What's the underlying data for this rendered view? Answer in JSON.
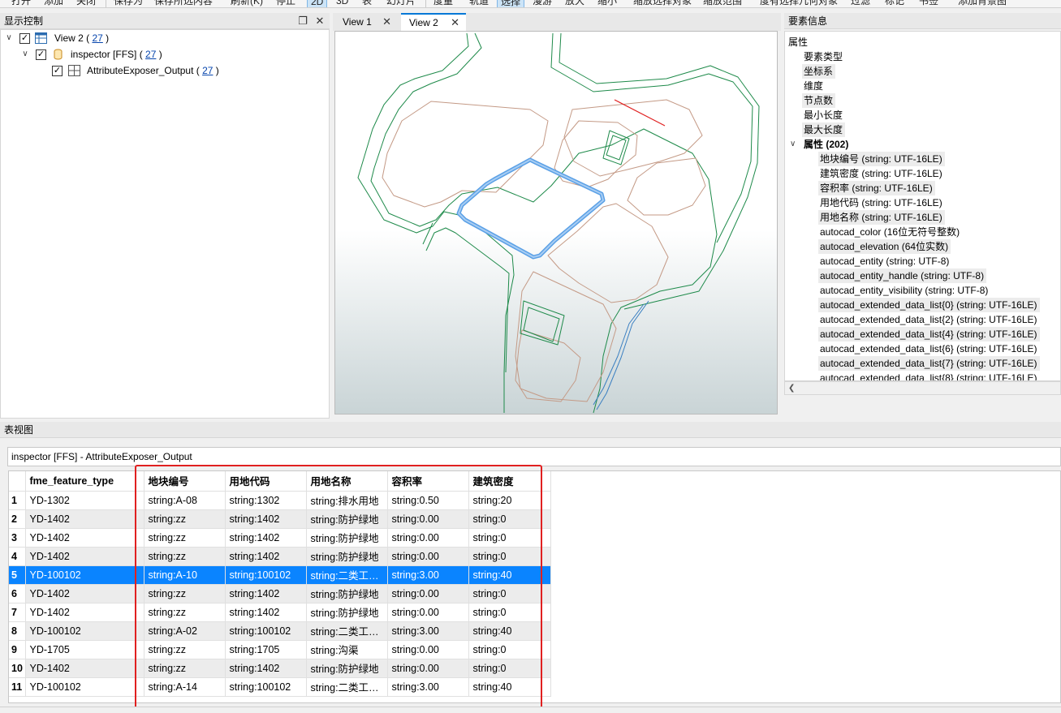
{
  "toolbar": {
    "items": [
      "打开",
      "添加",
      "关闭",
      "保存为",
      "保存所选内容",
      "刷新(K)",
      "停止",
      "2D",
      "3D",
      "表",
      "幻灯片",
      "度量",
      "轨道",
      "选择",
      "漫游",
      "放大",
      "缩小",
      "缩放选择对象",
      "缩放范围",
      "度有选择几何对象",
      "过滤",
      "标记",
      "书签",
      "添加背景图"
    ]
  },
  "display_control": {
    "title": "显示控制",
    "items": [
      {
        "label": "View 2",
        "count": "27"
      },
      {
        "label": "inspector [FFS]",
        "count": "27"
      },
      {
        "label": "AttributeExposer_Output",
        "count": "27"
      }
    ]
  },
  "tabs": [
    {
      "label": "View 1"
    },
    {
      "label": "View 2"
    }
  ],
  "feature_info": {
    "title": "要素信息",
    "root": "属性",
    "items": [
      "要素类型",
      "坐标系",
      "维度",
      "节点数",
      "最小长度",
      "最大长度"
    ],
    "attributes_group": "属性 (202)",
    "attributes": [
      "地块编号 (string: UTF-16LE)",
      "建筑密度 (string: UTF-16LE)",
      "容积率 (string: UTF-16LE)",
      "用地代码 (string: UTF-16LE)",
      "用地名称 (string: UTF-16LE)",
      "autocad_color (16位无符号整数)",
      "autocad_elevation (64位实数)",
      "autocad_entity (string: UTF-8)",
      "autocad_entity_handle (string: UTF-8)",
      "autocad_entity_visibility (string: UTF-8)",
      "autocad_extended_data_list{0} (string: UTF-16LE)",
      "autocad_extended_data_list{2} (string: UTF-16LE)",
      "autocad_extended_data_list{4} (string: UTF-16LE)",
      "autocad_extended_data_list{6} (string: UTF-16LE)",
      "autocad_extended_data_list{7} (string: UTF-16LE)",
      "autocad_extended_data_list{8} (string: UTF-16LE)"
    ]
  },
  "table_view": {
    "title": "表视图",
    "breadcrumb": "inspector [FFS] - AttributeExposer_Output",
    "columns": [
      "fme_feature_type",
      "地块编号",
      "用地代码",
      "用地名称",
      "容积率",
      "建筑密度"
    ],
    "selected_row": 5,
    "rows": [
      {
        "n": "1",
        "cells": [
          "YD-1302",
          "string:A-08",
          "string:1302",
          "string:排水用地",
          "string:0.50",
          "string:20"
        ]
      },
      {
        "n": "2",
        "cells": [
          "YD-1402",
          "string:zz",
          "string:1402",
          "string:防护绿地",
          "string:0.00",
          "string:0"
        ]
      },
      {
        "n": "3",
        "cells": [
          "YD-1402",
          "string:zz",
          "string:1402",
          "string:防护绿地",
          "string:0.00",
          "string:0"
        ]
      },
      {
        "n": "4",
        "cells": [
          "YD-1402",
          "string:zz",
          "string:1402",
          "string:防护绿地",
          "string:0.00",
          "string:0"
        ]
      },
      {
        "n": "5",
        "cells": [
          "YD-100102",
          "string:A-10",
          "string:100102",
          "string:二类工…",
          "string:3.00",
          "string:40"
        ]
      },
      {
        "n": "6",
        "cells": [
          "YD-1402",
          "string:zz",
          "string:1402",
          "string:防护绿地",
          "string:0.00",
          "string:0"
        ]
      },
      {
        "n": "7",
        "cells": [
          "YD-1402",
          "string:zz",
          "string:1402",
          "string:防护绿地",
          "string:0.00",
          "string:0"
        ]
      },
      {
        "n": "8",
        "cells": [
          "YD-100102",
          "string:A-02",
          "string:100102",
          "string:二类工…",
          "string:3.00",
          "string:40"
        ]
      },
      {
        "n": "9",
        "cells": [
          "YD-1705",
          "string:zz",
          "string:1705",
          "string:沟渠",
          "string:0.00",
          "string:0"
        ]
      },
      {
        "n": "10",
        "cells": [
          "YD-1402",
          "string:zz",
          "string:1402",
          "string:防护绿地",
          "string:0.00",
          "string:0"
        ]
      },
      {
        "n": "11",
        "cells": [
          "YD-100102",
          "string:A-14",
          "string:100102",
          "string:二类工…",
          "string:3.00",
          "string:40"
        ]
      }
    ]
  },
  "colors": {
    "selection": "#0a84ff",
    "map_road": "#1e8a4a",
    "map_parcel": "#c49a86",
    "map_selected": "#5aa0e6",
    "annotation_box": "#e02020"
  }
}
